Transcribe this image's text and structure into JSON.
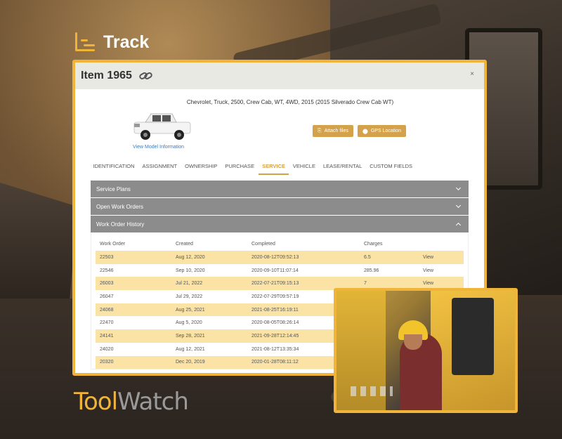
{
  "header": {
    "title": "Track"
  },
  "item": {
    "title": "Item 1965",
    "close_glyph": "×",
    "vehicle_description": "Chevrolet, Truck, 2500, Crew Cab, WT, 4WD, 2015 (2015 Silverado Crew Cab WT)",
    "view_model_label": "View Model Information",
    "attach_label": "Attach files",
    "gps_label": "GPS Location"
  },
  "tabs": [
    {
      "label": "IDENTIFICATION"
    },
    {
      "label": "ASSIGNMENT"
    },
    {
      "label": "OWNERSHIP"
    },
    {
      "label": "PURCHASE"
    },
    {
      "label": "SERVICE",
      "active": true
    },
    {
      "label": "VEHICLE"
    },
    {
      "label": "LEASE/RENTAL"
    },
    {
      "label": "CUSTOM FIELDS"
    }
  ],
  "sections": {
    "service_plans": "Service Plans",
    "open_work_orders": "Open Work Orders",
    "work_order_history": "Work Order History"
  },
  "table": {
    "columns": [
      "Work Order",
      "Created",
      "Completed",
      "Charges",
      ""
    ],
    "rows": [
      [
        "22503",
        "Aug 12, 2020",
        "2020-08-12T09:52:13",
        "6.5",
        "View"
      ],
      [
        "22546",
        "Sep 10, 2020",
        "2020-09-10T11:07:14",
        "285.96",
        "View"
      ],
      [
        "26003",
        "Jul 21, 2022",
        "2022-07-21T09:15:13",
        "7",
        "View"
      ],
      [
        "26047",
        "Jul 29, 2022",
        "2022-07-29T09:57:19",
        "",
        ""
      ],
      [
        "24068",
        "Aug 25, 2021",
        "2021-08-25T16:19:11",
        "",
        ""
      ],
      [
        "22470",
        "Aug 5, 2020",
        "2020-08-05T08:26:14",
        "",
        ""
      ],
      [
        "24141",
        "Sep 28, 2021",
        "2021-09-28T12:14:45",
        "",
        ""
      ],
      [
        "24020",
        "Aug 12, 2021",
        "2021-08-12T13:35:34",
        "",
        ""
      ],
      [
        "20320",
        "Dec 20, 2019",
        "2020-01-28T08:11:12",
        "",
        ""
      ]
    ]
  },
  "logo": {
    "part1": "Tool",
    "part2": "Watch"
  },
  "colors": {
    "accent": "#f0b43a",
    "button": "#d4a24a",
    "row_highlight": "#fbe3a6",
    "accordion": "#8c8c8c"
  }
}
